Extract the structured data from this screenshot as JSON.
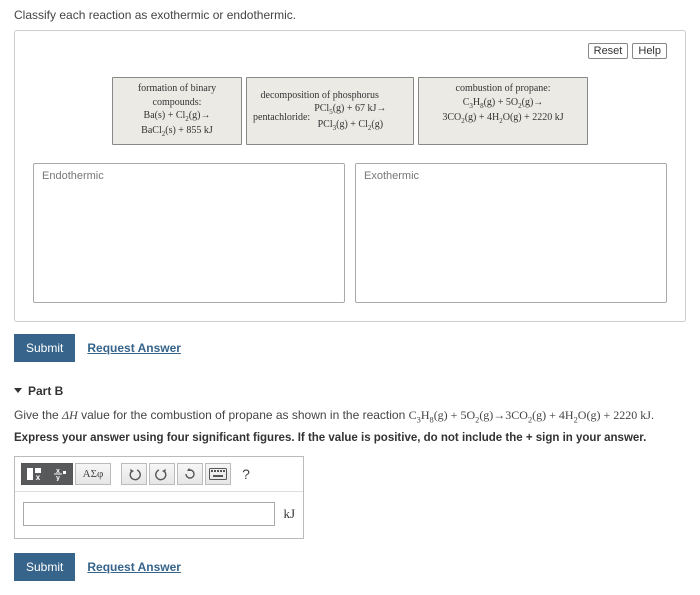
{
  "prompt": "Classify each reaction as exothermic or endothermic.",
  "toolbar": {
    "reset": "Reset",
    "help": "Help"
  },
  "cards": {
    "c1": {
      "title": "formation of binary compounds:",
      "line1_html": "Ba(s) + Cl<sub>2</sub>(g)→",
      "line2_html": "BaCl<sub>2</sub>(s) + 855 kJ"
    },
    "c2": {
      "title": "decomposition of phosphorus",
      "pre": "pentachloride:",
      "r1_html": "PCl<sub>5</sub>(g) + 67 kJ→",
      "r2_html": "PCl<sub>3</sub>(g) + Cl<sub>2</sub>(g)"
    },
    "c3": {
      "title": "combustion of propane:",
      "r1_html": "C<sub>3</sub>H<sub>8</sub>(g) + 5O<sub>2</sub>(g)→",
      "r2_html": "3CO<sub>2</sub>(g) + 4H<sub>2</sub>O(g) + 2220 kJ"
    }
  },
  "zones": {
    "left": "Endothermic",
    "right": "Exothermic"
  },
  "submit": "Submit",
  "request_answer": "Request Answer",
  "partB": {
    "heading": "Part B",
    "desc_prefix": "Give the ",
    "dh": "ΔH",
    "desc_mid": " value for the combustion of propane as shown in the reaction ",
    "reaction_html": "C<sub>3</sub>H<sub>8</sub>(g) + 5O<sub>2</sub>(g)→3CO<sub>2</sub>(g) + 4H<sub>2</sub>O(g) + 2220 kJ",
    "desc_suffix": ".",
    "instr": "Express your answer using four significant figures. If the value is positive, do not include the + sign in your answer.",
    "unit": "kJ",
    "input_value": "",
    "tb": {
      "greek": "ΑΣφ",
      "help": "?"
    }
  }
}
